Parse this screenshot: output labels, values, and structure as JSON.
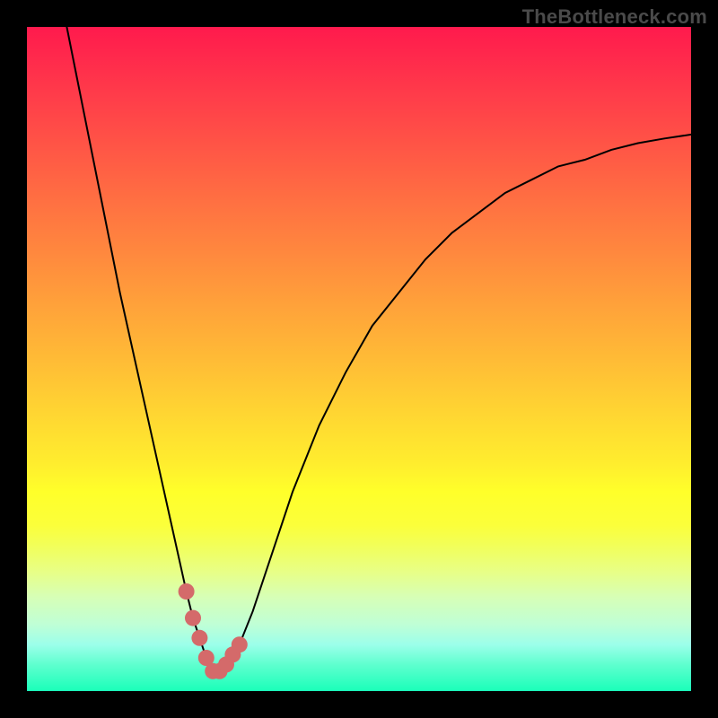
{
  "watermark": "TheBottleneck.com",
  "colors": {
    "frame": "#000000",
    "curve": "#000000",
    "marker": "#d46a6a",
    "gradient_top": "#ff1a4d",
    "gradient_bottom": "#1affb9"
  },
  "chart_data": {
    "type": "line",
    "title": "",
    "xlabel": "",
    "ylabel": "",
    "xlim": [
      0,
      100
    ],
    "ylim": [
      0,
      100
    ],
    "grid": false,
    "legend": false,
    "series": [
      {
        "name": "bottleneck-curve",
        "x": [
          6,
          8,
          10,
          12,
          14,
          16,
          18,
          20,
          22,
          24,
          25,
          26,
          27,
          28,
          29,
          30,
          32,
          34,
          36,
          38,
          40,
          44,
          48,
          52,
          56,
          60,
          64,
          68,
          72,
          76,
          80,
          84,
          88,
          92,
          96,
          100
        ],
        "y": [
          100,
          90,
          80,
          70,
          60,
          51,
          42,
          33,
          24,
          15,
          11,
          8,
          5,
          3,
          3,
          4,
          7,
          12,
          18,
          24,
          30,
          40,
          48,
          55,
          60,
          65,
          69,
          72,
          75,
          77,
          79,
          80,
          81.5,
          82.5,
          83.2,
          83.8
        ]
      }
    ],
    "markers": [
      {
        "name": "optimal-range",
        "x": [
          24,
          25,
          26,
          27,
          28,
          29,
          30,
          31,
          32
        ],
        "y": [
          15,
          11,
          8,
          5,
          3,
          3,
          4,
          5.5,
          7
        ]
      }
    ]
  }
}
